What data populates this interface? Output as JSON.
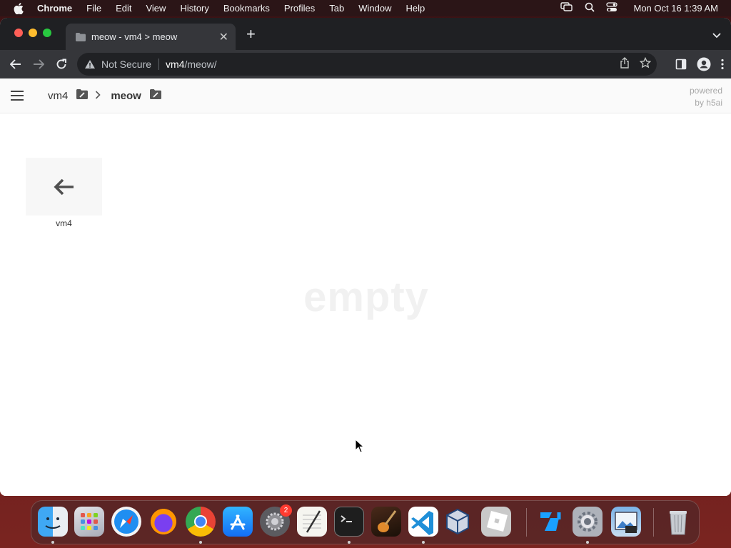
{
  "menubar": {
    "app_name": "Chrome",
    "items": [
      "File",
      "Edit",
      "View",
      "History",
      "Bookmarks",
      "Profiles",
      "Tab",
      "Window",
      "Help"
    ],
    "clock": "Mon Oct 16  1:39 AM"
  },
  "browser": {
    "tab_title": "meow - vm4 > meow",
    "security_label": "Not Secure",
    "url_host": "vm4",
    "url_path": "/meow/"
  },
  "page": {
    "breadcrumb": [
      "vm4",
      "meow"
    ],
    "powered_line1": "powered",
    "powered_line2": "by h5ai",
    "back_tile_label": "vm4",
    "empty_text": "empty"
  },
  "dock": {
    "apps": [
      "finder",
      "launchpad",
      "safari",
      "firefox",
      "chrome",
      "app-store",
      "system-preferences",
      "textedit",
      "terminal",
      "garageband",
      "vscode",
      "virtualbox",
      "roblox",
      "roblox-studio",
      "system-settings",
      "preview",
      "trash"
    ],
    "system_preferences_badge": "2"
  },
  "colors": {
    "accent_red": "#ff5f57",
    "accent_yellow": "#febc2e",
    "accent_green": "#28c840"
  }
}
